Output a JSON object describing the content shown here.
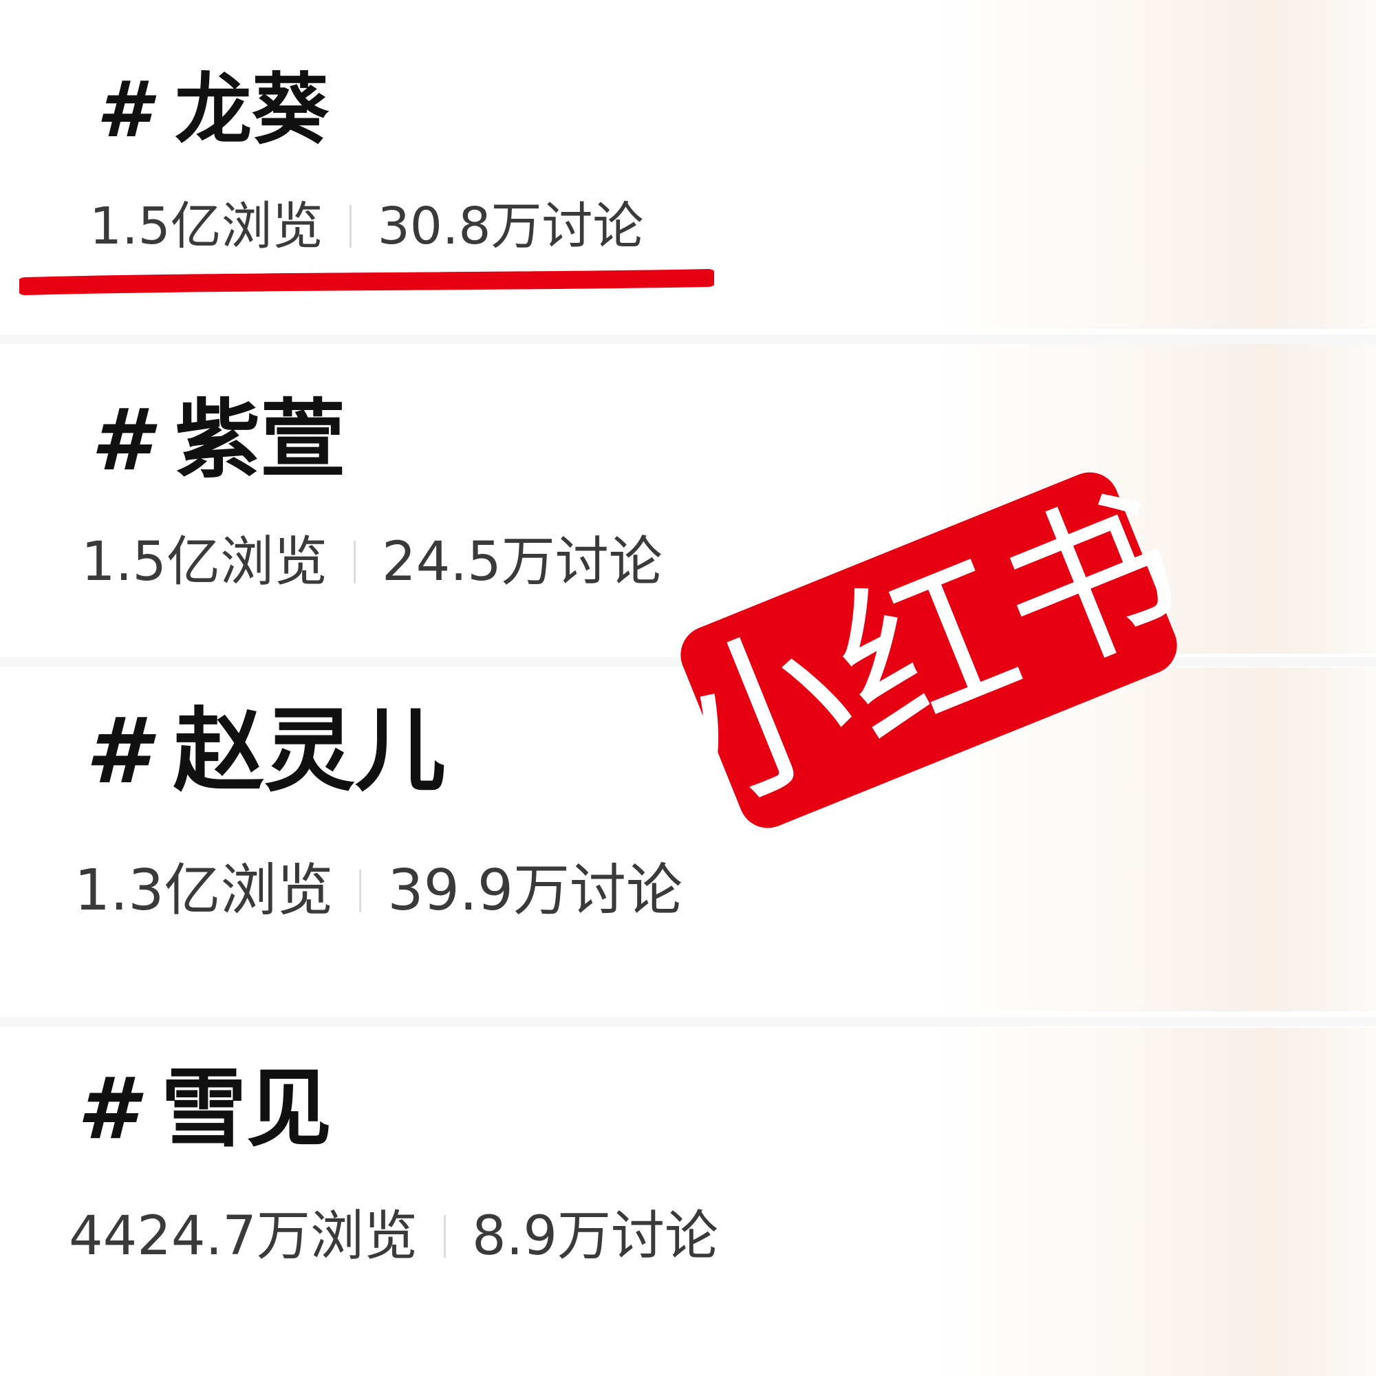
{
  "topics": [
    {
      "hash": "#",
      "title": "龙葵",
      "views": "1.5亿浏览",
      "discussions": "30.8万讨论"
    },
    {
      "hash": "#",
      "title": "紫萱",
      "views": "1.5亿浏览",
      "discussions": "24.5万讨论"
    },
    {
      "hash": "#",
      "title": "赵灵儿",
      "views": "1.3亿浏览",
      "discussions": "39.9万讨论"
    },
    {
      "hash": "#",
      "title": "雪见",
      "views": "4424.7万浏览",
      "discussions": "8.9万讨论"
    }
  ],
  "watermark": {
    "text": "小红书",
    "color": "#e60012"
  },
  "highlight": {
    "color": "#e60012",
    "target": "topic-1-stats"
  }
}
